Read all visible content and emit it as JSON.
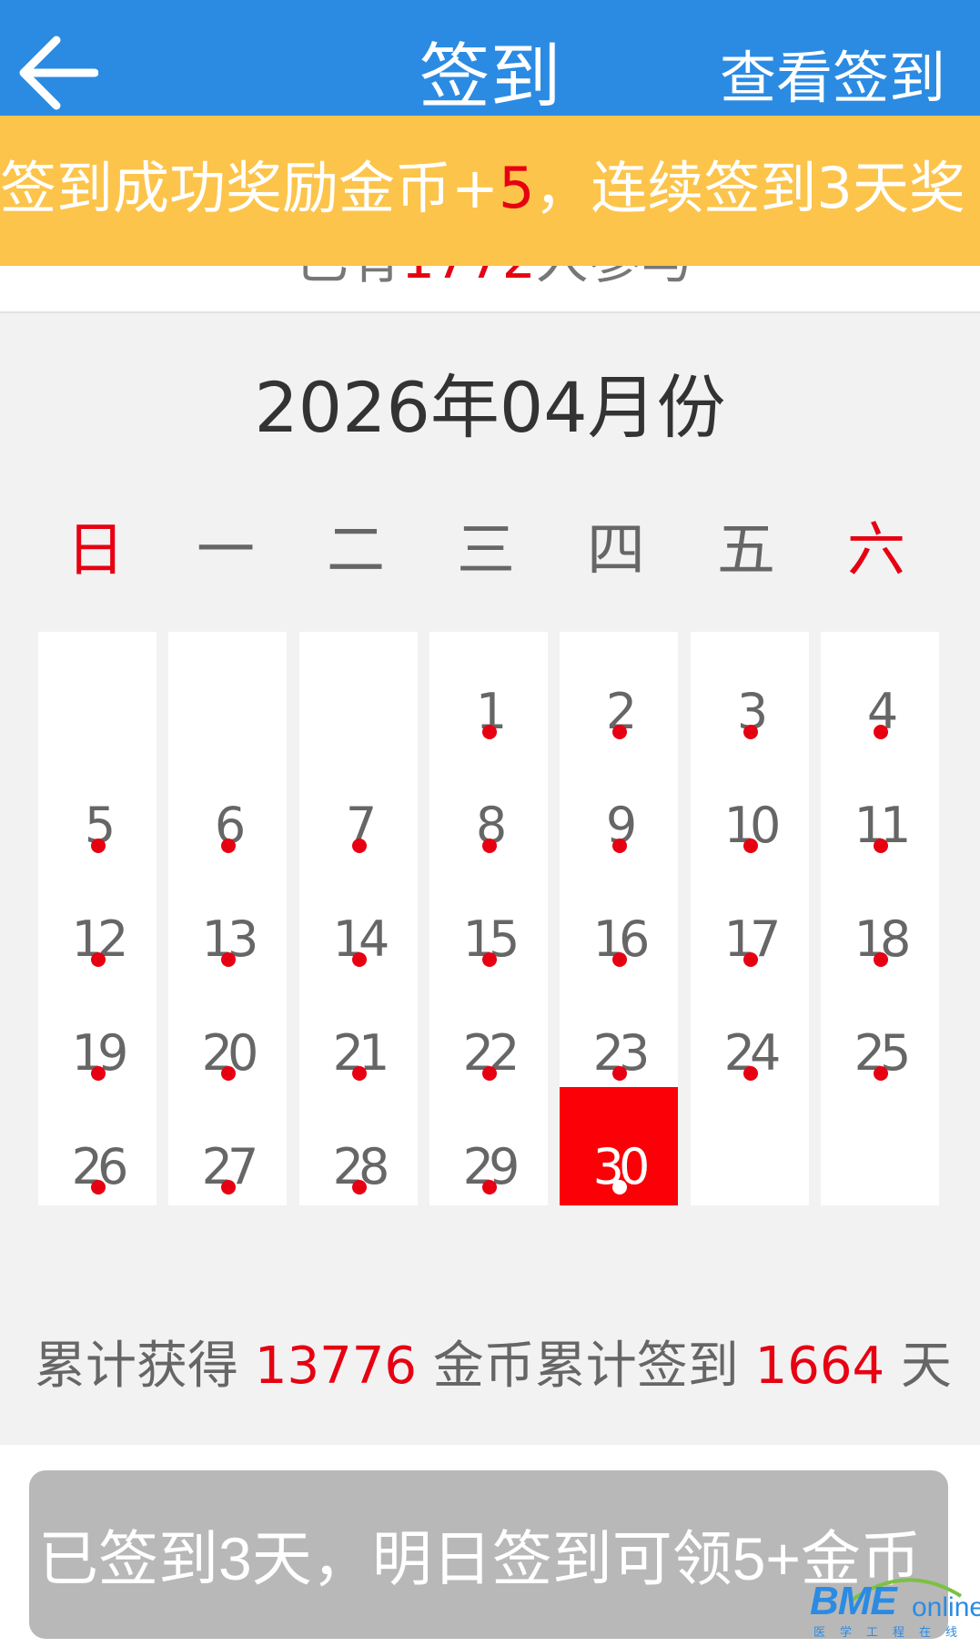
{
  "header": {
    "title": "签到",
    "right_action": "查看签到",
    "back_icon": "arrow-left-icon"
  },
  "banner": {
    "prefix": "签到成功奖励金币+",
    "amount": "5",
    "suffix": "，连续签到3天奖"
  },
  "participants": {
    "prefix": "已有",
    "count": "1772",
    "suffix": "人参与"
  },
  "calendar": {
    "month_title": "2026年04月份",
    "weekdays": [
      "日",
      "一",
      "二",
      "三",
      "四",
      "五",
      "六"
    ],
    "weekend_color": "#e60012",
    "rows": [
      [
        "",
        "",
        "",
        "1",
        "2",
        "3",
        "4"
      ],
      [
        "5",
        "6",
        "7",
        "8",
        "9",
        "10",
        "11"
      ],
      [
        "12",
        "13",
        "14",
        "15",
        "16",
        "17",
        "18"
      ],
      [
        "19",
        "20",
        "21",
        "22",
        "23",
        "24",
        "25"
      ],
      [
        "26",
        "27",
        "28",
        "29",
        "30",
        "",
        ""
      ]
    ],
    "today": "30",
    "today_color": "#fb0006",
    "signed_dot_color": "#e60012"
  },
  "summary": {
    "label1": "累计获得",
    "coins": "13776",
    "label2": "金币累计签到",
    "days": "1664",
    "label3": "天"
  },
  "signin_button": {
    "label": "已签到3天，明日签到可领5+金币"
  },
  "logo": {
    "main": "BME",
    "online": "online",
    "sub": "医学工程在线"
  },
  "colors": {
    "header_bg": "#2b8be3",
    "banner_bg": "#fcc44a",
    "accent_red": "#e60012",
    "button_disabled": "#b8b8b8"
  }
}
